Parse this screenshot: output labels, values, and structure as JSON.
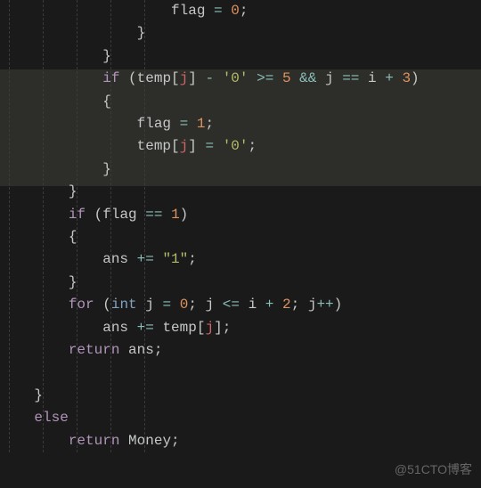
{
  "code": {
    "l1_flag": "flag",
    "l1_eq": "=",
    "l1_zero": "0",
    "l1_semi": ";",
    "l2_close": "}",
    "l3_close": "}",
    "l4_if": "if",
    "l4_lparen": "(",
    "l4_temp": "temp",
    "l4_lbrk": "[",
    "l4_j": "j",
    "l4_rbrk": "]",
    "l4_minus": "-",
    "l4_ch0": "'0'",
    "l4_gte": ">=",
    "l4_five": "5",
    "l4_and": "&&",
    "l4_j2": "j",
    "l4_eqeq": "==",
    "l4_i": "i",
    "l4_plus": "+",
    "l4_three": "3",
    "l4_rparen": ")",
    "l5_open": "{",
    "l6_flag": "flag",
    "l6_eq": "=",
    "l6_one": "1",
    "l6_semi": ";",
    "l7_temp": "temp",
    "l7_lbrk": "[",
    "l7_j": "j",
    "l7_rbrk": "]",
    "l7_eq": "=",
    "l7_ch0": "'0'",
    "l7_semi": ";",
    "l8_close": "}",
    "l9_close": "}",
    "l10_if": "if",
    "l10_lparen": "(",
    "l10_flag": "flag",
    "l10_eqeq": "==",
    "l10_one": "1",
    "l10_rparen": ")",
    "l11_open": "{",
    "l12_ans": "ans",
    "l12_pluseq": "+=",
    "l12_str1": "\"1\"",
    "l12_semi": ";",
    "l13_close": "}",
    "l14_for": "for",
    "l14_lparen": "(",
    "l14_int": "int",
    "l14_j": "j",
    "l14_eq": "=",
    "l14_zero": "0",
    "l14_semi1": ";",
    "l14_j2": "j",
    "l14_lte": "<=",
    "l14_i": "i",
    "l14_plus": "+",
    "l14_two": "2",
    "l14_semi2": ";",
    "l14_j3": "j",
    "l14_inc": "++",
    "l14_rparen": ")",
    "l15_ans": "ans",
    "l15_pluseq": "+=",
    "l15_temp": "temp",
    "l15_lbrk": "[",
    "l15_j": "j",
    "l15_rbrk": "]",
    "l15_semi": ";",
    "l16_return": "return",
    "l16_ans": "ans",
    "l16_semi": ";",
    "l18_close": "}",
    "l19_else": "else",
    "l20_return": "return",
    "l20_money": "Money",
    "l20_semi": ";"
  },
  "watermark": "@51CTO博客"
}
